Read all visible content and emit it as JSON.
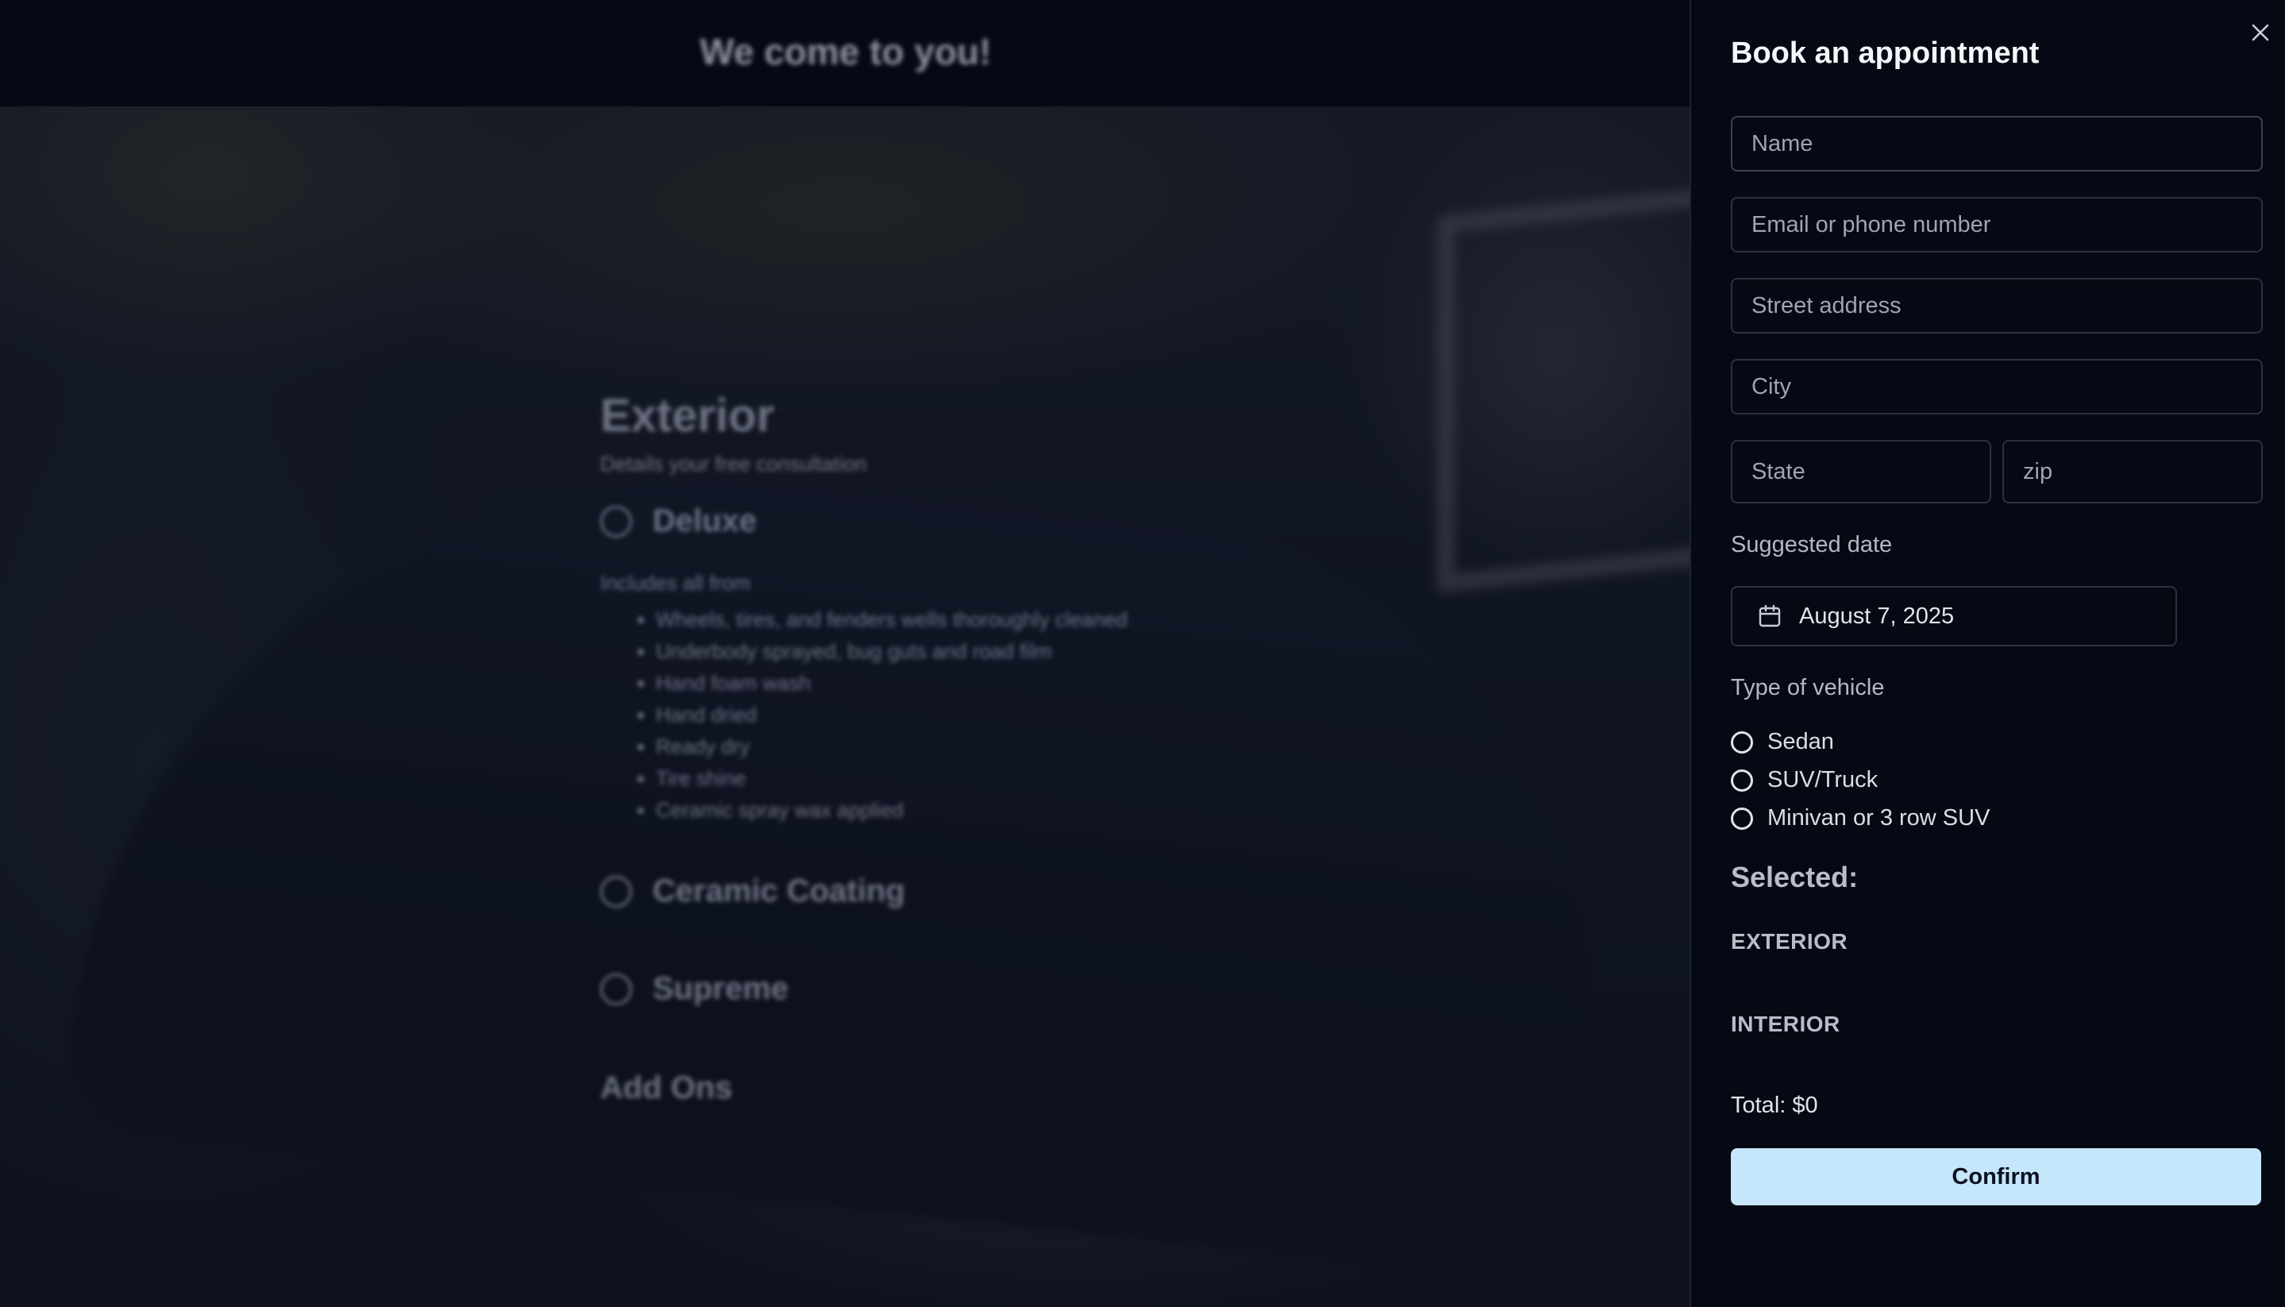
{
  "background": {
    "header_title": "We come to you!",
    "section_title": "Exterior",
    "section_subtitle": "Details your free consultation",
    "option_1": "Deluxe",
    "includes_label": "Includes all from",
    "list_items": [
      "Wheels, tires, and fenders wells thoroughly cleaned",
      "Underbody sprayed, bug guts and road film",
      "Hand foam wash",
      "Hand dried",
      "Ready dry",
      "Tire shine",
      "Ceramic spray wax applied"
    ],
    "option_2": "Ceramic Coating",
    "option_3": "Supreme",
    "addons_label": "Add Ons"
  },
  "panel": {
    "title": "Book an appointment",
    "close_icon": "close-icon",
    "fields": {
      "name_placeholder": "Name",
      "contact_placeholder": "Email or phone number",
      "street_placeholder": "Street address",
      "city_placeholder": "City",
      "state_placeholder": "State",
      "zip_placeholder": "zip"
    },
    "date_label": "Suggested date",
    "date_value": "August 7, 2025",
    "date_icon": "calendar-icon",
    "vehicle_label": "Type of vehicle",
    "vehicle_options": [
      "Sedan",
      "SUV/Truck",
      "Minivan or 3 row SUV"
    ],
    "selected_heading": "Selected:",
    "exterior_heading": "EXTERIOR",
    "interior_heading": "INTERIOR",
    "total": "Total: $0",
    "confirm_label": "Confirm"
  },
  "colors": {
    "panel_bg": "#050913",
    "confirm_bg": "#c5e6fb",
    "field_border": "#2b3142"
  }
}
